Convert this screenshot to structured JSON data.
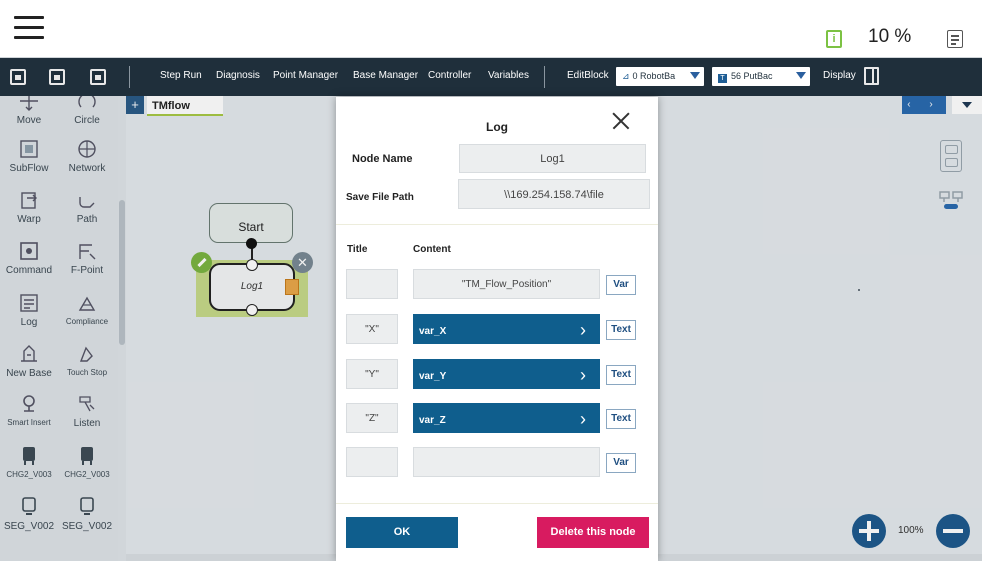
{
  "topbar": {
    "speed": "10 %",
    "info_icon_glyph": "i"
  },
  "toolbar": {
    "buttons": [
      "Step Run",
      "Diagnosis",
      "Point Manager",
      "Base Manager",
      "Controller",
      "Variables",
      "EditBlock"
    ],
    "robot_select": "0 RobotBa",
    "base_select": "56 PutBac",
    "base_select_glyph": "T",
    "display": "Display"
  },
  "palette": {
    "items": [
      {
        "label": "Move",
        "icon": "move-icon"
      },
      {
        "label": "Circle",
        "icon": "circle-icon"
      },
      {
        "label": "SubFlow",
        "icon": "subflow-icon"
      },
      {
        "label": "Network",
        "icon": "network-icon"
      },
      {
        "label": "Warp",
        "icon": "warp-icon"
      },
      {
        "label": "Path",
        "icon": "path-icon"
      },
      {
        "label": "Command",
        "icon": "command-icon"
      },
      {
        "label": "F-Point",
        "icon": "f-point-icon"
      },
      {
        "label": "Log",
        "icon": "log-icon"
      },
      {
        "label": "Compliance",
        "icon": "compliance-icon"
      },
      {
        "label": "New Base",
        "icon": "new-base-icon"
      },
      {
        "label": "Touch Stop",
        "icon": "touch-stop-icon"
      },
      {
        "label": "Smart Insert",
        "icon": "smart-insert-icon"
      },
      {
        "label": "Listen",
        "icon": "listen-icon"
      },
      {
        "label": "CHG2_V003",
        "icon": "gripper-icon"
      },
      {
        "label": "CHG2_V003",
        "icon": "gripper-icon"
      },
      {
        "label": "SEG_V002",
        "icon": "screwdriver-icon"
      },
      {
        "label": "SEG_V002",
        "icon": "screwdriver-icon"
      }
    ]
  },
  "canvas": {
    "tab_add": "+",
    "tab_label": "TMflow",
    "nav_arrows": "‹ ›",
    "start_node": "Start",
    "log_node": "Log1",
    "delete_glyph": "✕",
    "zoom": "100%"
  },
  "modal": {
    "title": "Log",
    "node_name_label": "Node Name",
    "node_name_value": "Log1",
    "save_path_label": "Save File Path",
    "save_path_value": "\\\\169.254.158.74\\file",
    "title_col": "Title",
    "content_col": "Content",
    "rows": [
      {
        "title": "",
        "content": "\"TM_Flow_Position\"",
        "variable": false,
        "type_button": "Var"
      },
      {
        "title": "\"X\"",
        "content": "var_X",
        "variable": true,
        "type_button": "Text"
      },
      {
        "title": "\"Y\"",
        "content": "var_Y",
        "variable": true,
        "type_button": "Text"
      },
      {
        "title": "\"Z\"",
        "content": "var_Z",
        "variable": true,
        "type_button": "Text"
      },
      {
        "title": "",
        "content": "",
        "variable": false,
        "type_button": "Var"
      }
    ],
    "ok": "OK",
    "delete": "Delete this node"
  },
  "colors": {
    "toolbar_bg": "#1f2f3b",
    "primary_blue": "#0f5e8d",
    "delete_pink": "#d81b60",
    "node_green": "#7bb442",
    "info_green": "#7cc243"
  }
}
